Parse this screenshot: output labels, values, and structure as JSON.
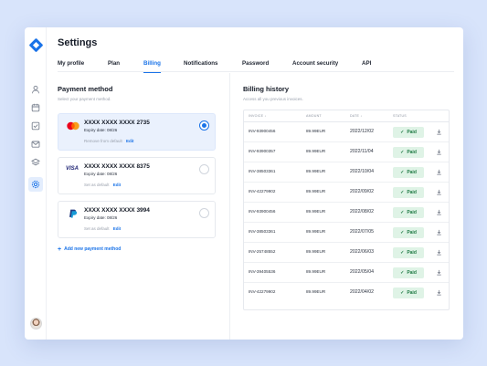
{
  "header": {
    "title": "Settings"
  },
  "tabs": [
    {
      "label": "My profile",
      "active": false
    },
    {
      "label": "Plan",
      "active": false
    },
    {
      "label": "Billing",
      "active": true
    },
    {
      "label": "Notifications",
      "active": false
    },
    {
      "label": "Password",
      "active": false
    },
    {
      "label": "Account security",
      "active": false
    },
    {
      "label": "API",
      "active": false
    }
  ],
  "sidebar": {
    "icons": [
      "user-icon",
      "calendar-icon",
      "checkbox-icon",
      "mail-icon",
      "layers-icon",
      "settings-icon"
    ],
    "active": "settings-icon"
  },
  "payment": {
    "title": "Payment method",
    "subtitle": "Select your payment method.",
    "cards": [
      {
        "brand": "mastercard",
        "number": "XXXX XXXX XXXX 2735",
        "expiry": "Expiry date: 08/26",
        "action": "Remove from default",
        "edit": "Edit",
        "selected": true
      },
      {
        "brand": "visa",
        "brand_label": "VISA",
        "number": "XXXX XXXX XXXX 8375",
        "expiry": "Expiry date: 08/26",
        "action": "Set as default",
        "edit": "Edit",
        "selected": false
      },
      {
        "brand": "paypal",
        "number": "XXXX XXXX XXXX 3994",
        "expiry": "Expiry date: 08/26",
        "action": "Set as default",
        "edit": "Edit",
        "selected": false
      }
    ],
    "add_label": "Add new payment method"
  },
  "billing": {
    "title": "Billing history",
    "subtitle": "Access all you previous invoices.",
    "columns": [
      "INVOICE",
      "AMOUNT",
      "DATE",
      "STATUS"
    ],
    "rows": [
      {
        "invoice": "INV-93900456",
        "amount": "89.99EUR",
        "date": "2022/12/02",
        "status": "Paid"
      },
      {
        "invoice": "INV-93900357",
        "amount": "89.99EUR",
        "date": "2022/11/04",
        "status": "Paid"
      },
      {
        "invoice": "INV-38503361",
        "amount": "89.99EUR",
        "date": "2022/10/04",
        "status": "Paid"
      },
      {
        "invoice": "INV-42279902",
        "amount": "89.99EUR",
        "date": "2022/09/02",
        "status": "Paid"
      },
      {
        "invoice": "INV-93900456",
        "amount": "89.99EUR",
        "date": "2022/08/02",
        "status": "Paid"
      },
      {
        "invoice": "INV-38503361",
        "amount": "89.99EUR",
        "date": "2022/07/05",
        "status": "Paid"
      },
      {
        "invoice": "INV-25748552",
        "amount": "89.99EUR",
        "date": "2022/06/03",
        "status": "Paid"
      },
      {
        "invoice": "INV-39405536",
        "amount": "89.99EUR",
        "date": "2022/05/04",
        "status": "Paid"
      },
      {
        "invoice": "INV-42279902",
        "amount": "89.99EUR",
        "date": "2022/04/02",
        "status": "Paid"
      }
    ]
  },
  "colors": {
    "accent": "#1a73e8",
    "paid_bg": "#dff3e6",
    "paid_text": "#1e7a43",
    "background": "#d8e4fb"
  }
}
